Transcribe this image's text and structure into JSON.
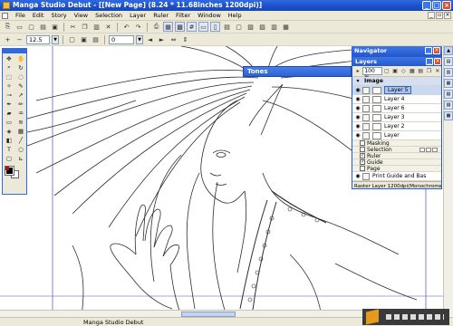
{
  "window": {
    "title": "Manga Studio Debut - [[New Page] (8.24 * 11.68inches 1200dpi)]"
  },
  "menu": {
    "items": [
      "File",
      "Edit",
      "Story",
      "View",
      "Selection",
      "Layer",
      "Ruler",
      "Filter",
      "Window",
      "Help"
    ]
  },
  "toolbar2": {
    "zoom_value": "12.5",
    "rotation_value": "0"
  },
  "tones": {
    "title": "Tones"
  },
  "navigator": {
    "title": "Navigator"
  },
  "layers": {
    "title": "Layers",
    "zoom": "100 %",
    "group_label": "Image",
    "items": [
      {
        "name": "Layer 5",
        "selected": true
      },
      {
        "name": "Layer 4",
        "selected": false
      },
      {
        "name": "Layer 6",
        "selected": false
      },
      {
        "name": "Layer 3",
        "selected": false
      },
      {
        "name": "Layer 2",
        "selected": false
      },
      {
        "name": "Layer",
        "selected": false
      }
    ],
    "sub_items": [
      "Masking",
      "Selection",
      "Ruler",
      "Guide",
      "Page"
    ],
    "page_item": "Print Guide and Bas",
    "status": "Raster Layer 1200dpi(Monochrome ("
  },
  "statusbar": {
    "app_name": "Manga Studio Debut"
  },
  "colors": {
    "titlebar": "#2459cf",
    "chrome": "#ece9d8",
    "selection": "#316ac5"
  }
}
